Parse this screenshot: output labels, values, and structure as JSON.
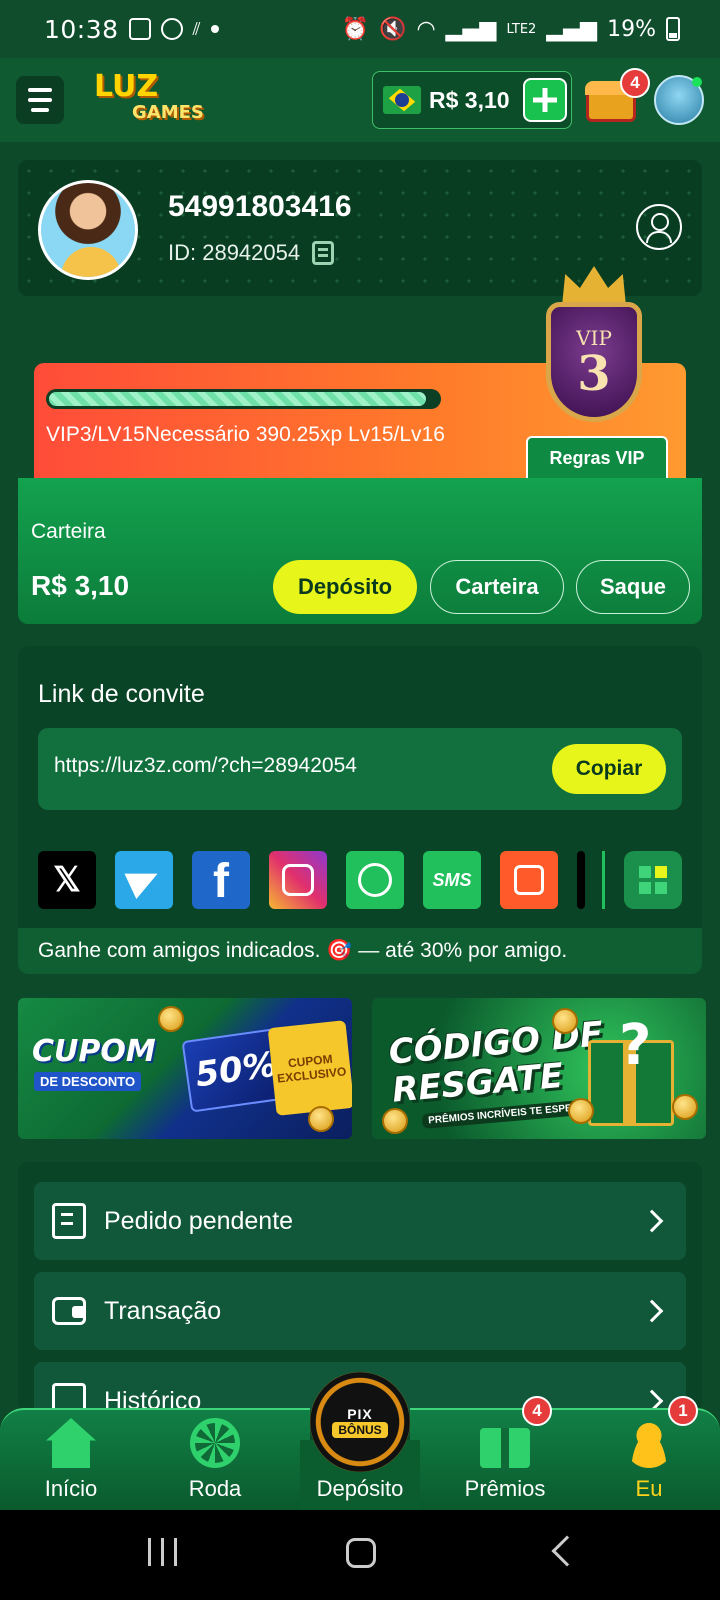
{
  "status_bar": {
    "time": "10:38",
    "network": "LTE2",
    "battery": "19%"
  },
  "header": {
    "logo_line1": "LUZ",
    "logo_line2": "GAMES",
    "balance": "R$ 3,10",
    "chest_badge": "4"
  },
  "profile": {
    "username": "54991803416",
    "id_text": "ID: 28942054"
  },
  "vip": {
    "progress_fraction": 0.97,
    "status_text": "VIP3/LV15Necessário 390.25xp Lv15/Lv16",
    "rules_button": "Regras VIP",
    "emblem_label": "VIP",
    "emblem_level": "3"
  },
  "wallet": {
    "label": "Carteira",
    "amount": "R$ 3,10",
    "deposit_button": "Depósito",
    "wallet_button": "Carteira",
    "withdraw_button": "Saque"
  },
  "invite": {
    "title": "Link de convite",
    "link": "https://luz3z.com/?ch=28942054",
    "copy_button": "Copiar",
    "share_x": "𝕏",
    "share_fb": "f",
    "share_sms": "SMS",
    "note": "Ganhe com amigos indicados. 🎯 — até 30% por amigo."
  },
  "banners": {
    "cupom_title": "CUPOM",
    "cupom_sub": "DE DESCONTO",
    "cupom_pct": "50%",
    "cupom_exclusive": "CUPOM EXCLUSIVO",
    "codigo_title": "CÓDIGO DE RESGATE",
    "codigo_sub": "PRÊMIOS INCRÍVEIS TE ESPERAM!"
  },
  "menu": {
    "items": [
      {
        "label": "Pedido pendente"
      },
      {
        "label": "Transação"
      },
      {
        "label": "Histórico"
      }
    ]
  },
  "bottom_nav": {
    "items": [
      {
        "label": "Início"
      },
      {
        "label": "Roda"
      },
      {
        "label": "Depósito"
      },
      {
        "label": "Prêmios"
      },
      {
        "label": "Eu"
      }
    ],
    "center_pix": "PIX",
    "center_bonus": "BÔNUS",
    "premios_badge": "4",
    "eu_badge": "1"
  },
  "colors": {
    "background": "#0d4a2a",
    "accent_yellow": "#e8f51a",
    "active_nav": "#ffd21a",
    "badge_red": "#e63b3b"
  }
}
